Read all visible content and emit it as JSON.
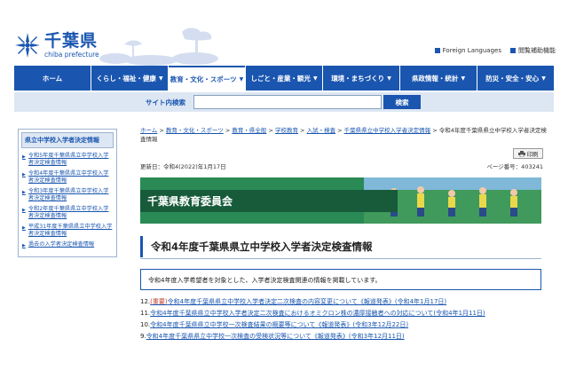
{
  "header": {
    "logo_main": "千葉県",
    "logo_sub": "chiba prefecture",
    "links": [
      "Foreign Languages",
      "閲覧補助機能"
    ]
  },
  "nav": {
    "items": [
      {
        "label": "ホーム",
        "active": false
      },
      {
        "label": "くらし・福祉・健康",
        "active": false
      },
      {
        "label": "教育・文化・スポーツ",
        "active": true
      },
      {
        "label": "しごと・産業・観光",
        "active": false
      },
      {
        "label": "環境・まちづくり",
        "active": false
      },
      {
        "label": "県政情報・統計",
        "active": false
      },
      {
        "label": "防災・安全・安心",
        "active": false
      }
    ]
  },
  "search": {
    "label": "サイト内検索",
    "placeholder": "",
    "button": "検索"
  },
  "sidebar": {
    "title": "県立中学校入学者決定情報",
    "items": [
      "令和5年度千葉県県立中学校入学者決定検査情報",
      "令和4年度千葉県県立中学校入学者決定検査情報",
      "令和3年度千葉県県立中学校入学者決定検査情報",
      "令和2年度千葉県県立中学校入学者決定検査情報",
      "平成31年度千葉県県立中学校入学者決定検査情報",
      "過去の入学者決定検査情報"
    ]
  },
  "breadcrumb": {
    "links": [
      "ホーム",
      "教育・文化・スポーツ",
      "教育・県全般",
      "学校教育",
      "入試・検査",
      "千葉県県立中学校入学者決定情報"
    ],
    "current": "令和4年度千葉県県立中学校入学者決定検査情報"
  },
  "print_label": "印刷",
  "updated": "更新日：令和4(2022)年1月17日",
  "page_id": "ページ番号：403241",
  "banner_title": "千葉県教育委員会",
  "page_title": "令和4年度千葉県県立中学校入学者決定検査情報",
  "intro": "令和4年度入学希望者を対象とした、入学者決定検査関連の情報を掲載しています。",
  "news": [
    {
      "num": "12.",
      "tag": "(重要)",
      "text": "令和4年度千葉県県立中学校入学者決定二次検査の内容変更について《報道発表》(令和4年1月17日)"
    },
    {
      "num": "11.",
      "tag": "",
      "text": "令和4年度千葉県県立中学校入学者決定二次検査におけるオミクロン株の濃厚接触者への対応について(令和4年1月11日)"
    },
    {
      "num": "10.",
      "tag": "",
      "text": "令和4年度千葉県県立中学校一次検査結果の概要等について《報道発表》(令和3年12月22日)"
    },
    {
      "num": "9.",
      "tag": "",
      "text": "令和4年度千葉県県立中学校一次検査の受検状況等について《報道発表》(令和3年12月11日)"
    }
  ],
  "colors": {
    "brand_blue": "#1a56b0",
    "banner_green": "#2a8a55",
    "alert_red": "#c0392b"
  }
}
